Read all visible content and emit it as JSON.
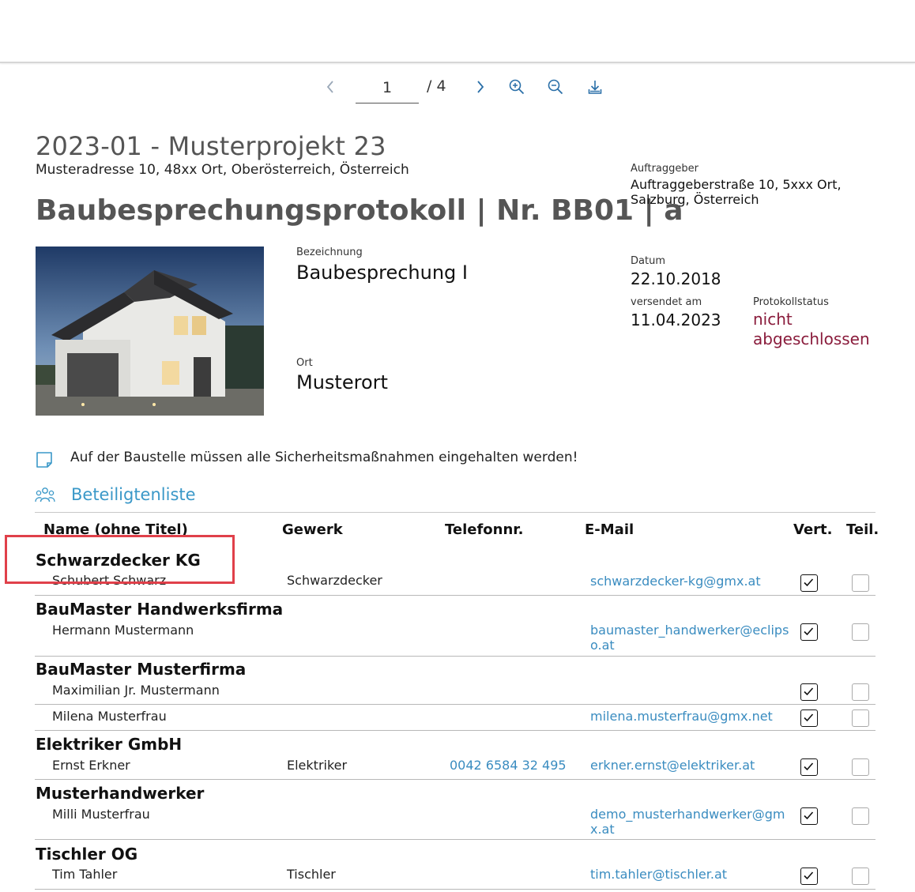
{
  "pager": {
    "current_page": "1",
    "total": "/ 4"
  },
  "project": {
    "title": "2023-01 - Musterprojekt 23",
    "address": "Musteradresse 10, 48xx Ort, Oberösterreich, Österreich"
  },
  "document": {
    "title": "Baubesprechungsprotokoll | Nr. BB01 | a"
  },
  "client": {
    "label": "Auftraggeber",
    "line1": "Auftraggeberstraße 10, 5xxx Ort,",
    "line2": "Salzburg, Österreich"
  },
  "meta": {
    "bezeichnung_label": "Bezeichnung",
    "bezeichnung_value": "Baubesprechung I",
    "ort_label": "Ort",
    "ort_value": "Musterort",
    "datum_label": "Datum",
    "datum_value": "22.10.2018",
    "versendet_label": "versendet am",
    "versendet_value": "11.04.2023",
    "status_label": "Protokollstatus",
    "status_value": "nicht abgeschlossen"
  },
  "note": {
    "text": "Auf der Baustelle müssen alle Sicherheitsmaßnahmen eingehalten werden!"
  },
  "participants": {
    "title": "Beteiligtenliste",
    "columns": {
      "name": "Name (ohne Titel)",
      "gewerk": "Gewerk",
      "phone": "Telefonnr.",
      "email": "E-Mail",
      "vert": "Vert.",
      "teil": "Teil."
    },
    "groups": [
      {
        "company": "Schwarzdecker KG",
        "people": [
          {
            "name": "Schubert Schwarz",
            "gewerk": "Schwarzdecker",
            "phone": "",
            "email": "schwarzdecker-kg@gmx.at",
            "vert": true,
            "teil": false
          }
        ]
      },
      {
        "company": "BauMaster Handwerksfirma",
        "people": [
          {
            "name": "Hermann Mustermann",
            "gewerk": "",
            "phone": "",
            "email": "baumaster_handwerker@eclipso.at",
            "vert": true,
            "teil": false
          }
        ]
      },
      {
        "company": "BauMaster Musterfirma",
        "people": [
          {
            "name": "Maximilian Jr. Mustermann",
            "gewerk": "",
            "phone": "",
            "email": "",
            "vert": true,
            "teil": false
          },
          {
            "name": "Milena Musterfrau",
            "gewerk": "",
            "phone": "",
            "email": "milena.musterfrau@gmx.net",
            "vert": true,
            "teil": false
          }
        ]
      },
      {
        "company": "Elektriker GmbH",
        "people": [
          {
            "name": "Ernst Erkner",
            "gewerk": "Elektriker",
            "phone": "0042 6584 32 495",
            "email": "erkner.ernst@elektriker.at",
            "vert": true,
            "teil": false
          }
        ]
      },
      {
        "company": "Musterhandwerker",
        "people": [
          {
            "name": "Milli Musterfrau",
            "gewerk": "",
            "phone": "",
            "email": "demo_musterhandwerker@gmx.at",
            "vert": true,
            "teil": false
          }
        ]
      },
      {
        "company": "Tischler OG",
        "people": [
          {
            "name": "Tim Tahler",
            "gewerk": "Tischler",
            "phone": "",
            "email": "tim.tahler@tischler.at",
            "vert": true,
            "teil": false
          }
        ]
      }
    ]
  },
  "colors": {
    "accent_blue": "#3a98c8",
    "status_red": "#8a1c3c",
    "highlight": "#e0404a"
  }
}
